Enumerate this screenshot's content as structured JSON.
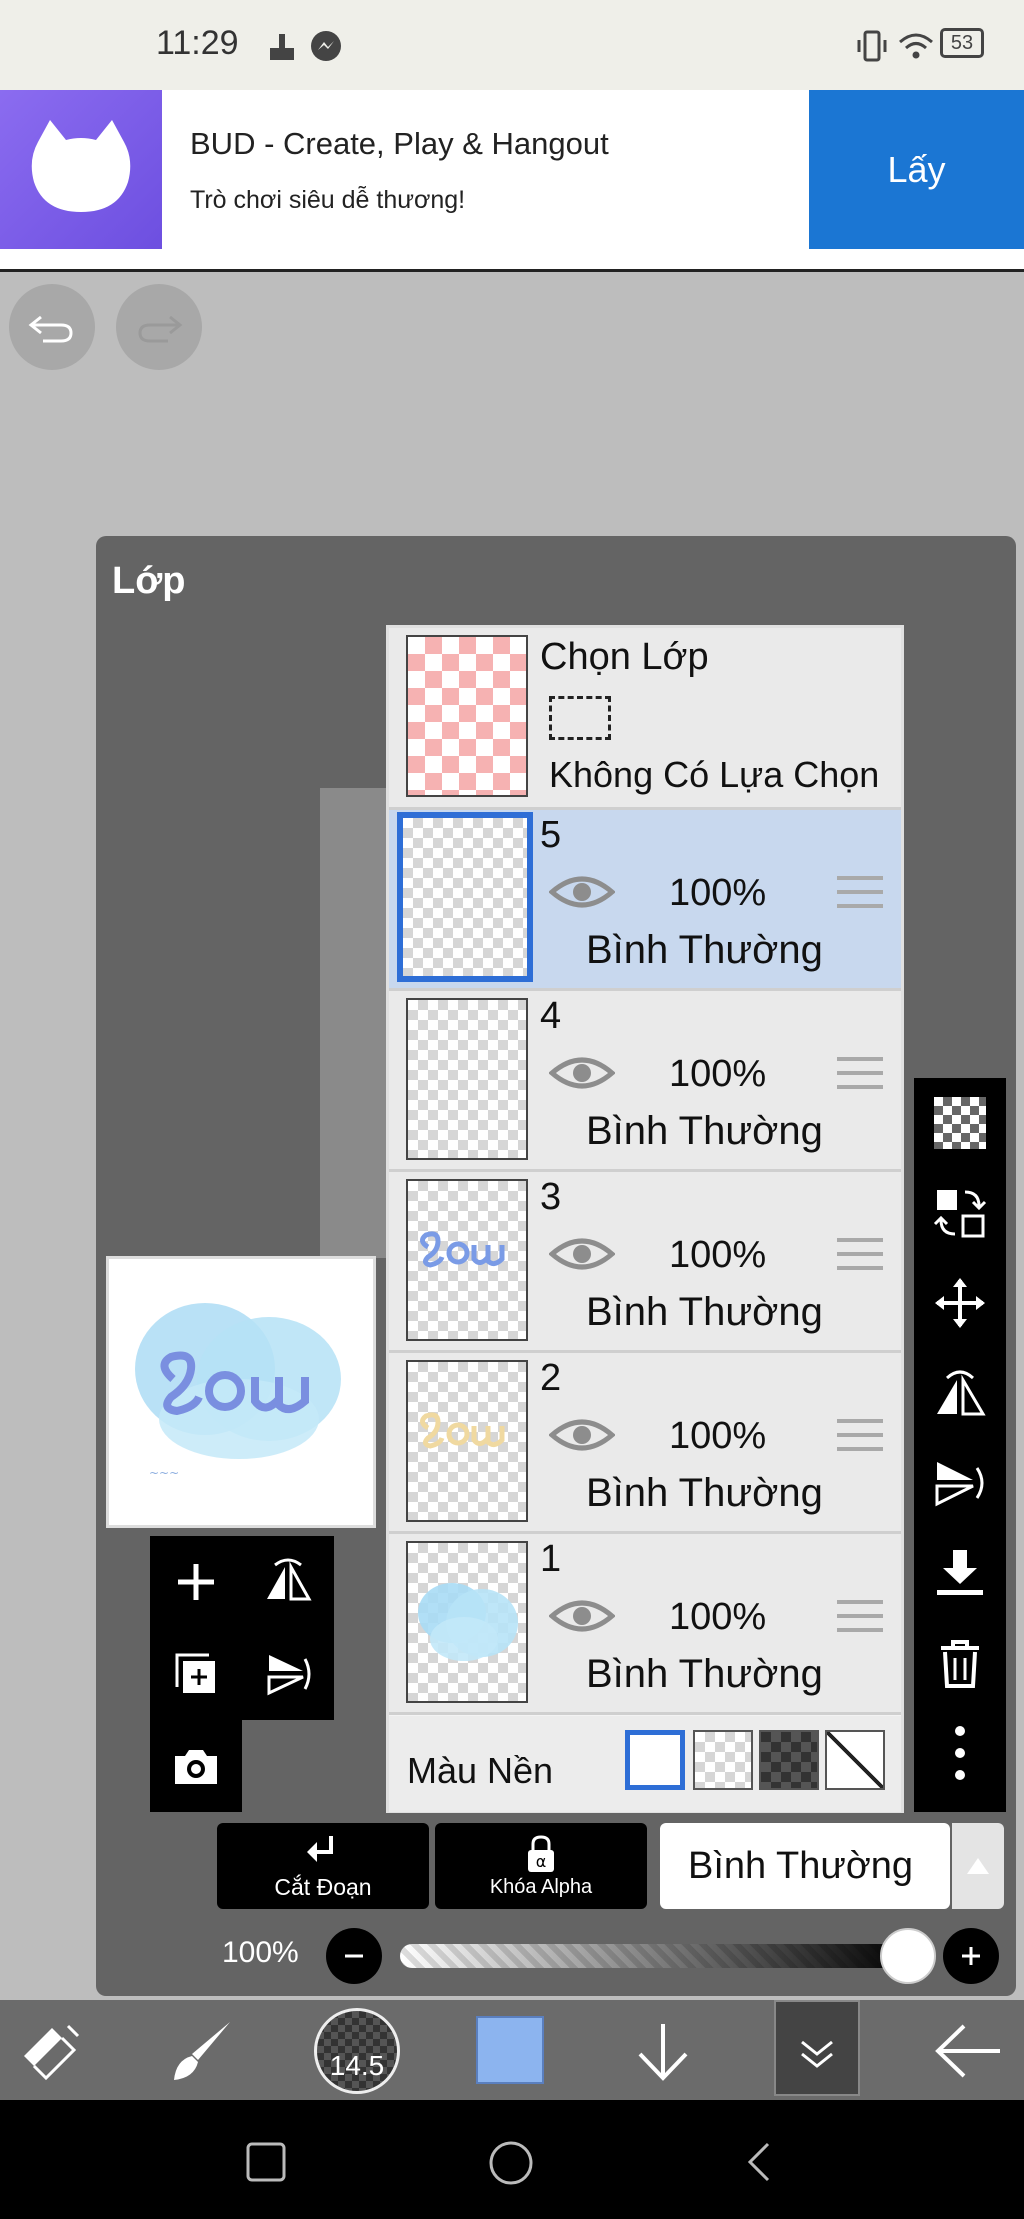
{
  "status_bar": {
    "time": "11:29",
    "battery": "53"
  },
  "ad": {
    "title": "BUD - Create, Play & Hangout",
    "subtitle": "Trò chơi siêu dễ thương!",
    "cta": "Lấy"
  },
  "panel": {
    "title": "Lớp"
  },
  "select_layer": {
    "label": "Chọn Lớp",
    "status": "Không Có Lựa Chọn"
  },
  "layers": [
    {
      "number": "5",
      "opacity": "100%",
      "blend": "Bình Thường",
      "selected": true
    },
    {
      "number": "4",
      "opacity": "100%",
      "blend": "Bình Thường",
      "selected": false
    },
    {
      "number": "3",
      "opacity": "100%",
      "blend": "Bình Thường",
      "selected": false
    },
    {
      "number": "2",
      "opacity": "100%",
      "blend": "Bình Thường",
      "selected": false
    },
    {
      "number": "1",
      "opacity": "100%",
      "blend": "Bình Thường",
      "selected": false
    }
  ],
  "background": {
    "label": "Màu Nền"
  },
  "actions": {
    "clip": "Cắt Đoạn",
    "alpha_lock": "Khóa Alpha",
    "blend_mode": "Bình Thường"
  },
  "opacity": {
    "label": "100%",
    "value": 1.0
  },
  "toolbar": {
    "brush_size": "14.5",
    "color": "#8cb4ef"
  },
  "colors": {
    "accent": "#2e6ed6",
    "ad_button": "#1b76d3",
    "selected_row": "#c8d8ee"
  }
}
